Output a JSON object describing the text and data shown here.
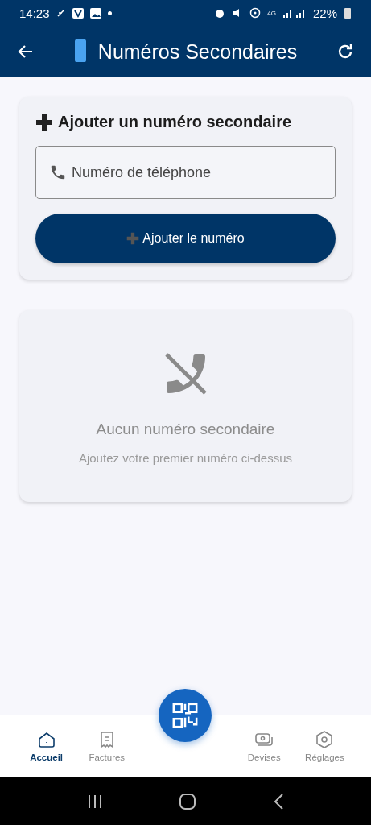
{
  "status_bar": {
    "time": "14:23",
    "network": "4G",
    "battery": "22%"
  },
  "app_bar": {
    "title": "Numéros Secondaires"
  },
  "add_card": {
    "title": "Ajouter un numéro secondaire",
    "phone_field": {
      "placeholder": "Numéro de téléphone"
    },
    "button": "Ajouter le numéro"
  },
  "empty_state": {
    "title": "Aucun numéro secondaire",
    "subtitle": "Ajoutez votre premier numéro ci-dessus"
  },
  "bottom_nav": {
    "items": [
      {
        "kind": "home",
        "label": "Accueil",
        "selected": true
      },
      {
        "kind": "invoice",
        "label": "Factures",
        "selected": false
      },
      {
        "kind": "currency",
        "label": "Devises",
        "selected": false
      },
      {
        "kind": "settings",
        "label": "Réglages",
        "selected": false
      }
    ]
  }
}
